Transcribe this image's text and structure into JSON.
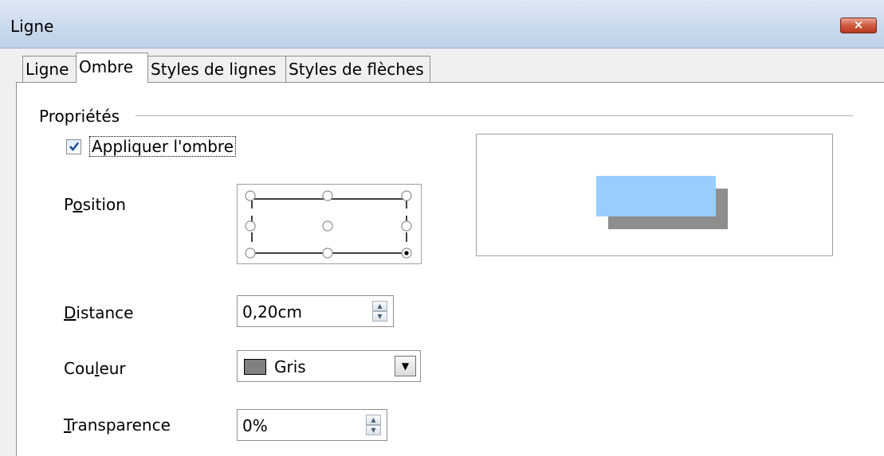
{
  "window": {
    "title": "Ligne",
    "close_label": "×"
  },
  "tabs": [
    {
      "label": "Ligne",
      "active": false
    },
    {
      "label": "Ombre",
      "active": true
    },
    {
      "label": "Styles de lignes",
      "active": false
    },
    {
      "label": "Styles de flèches",
      "active": false
    }
  ],
  "section": {
    "title": "Propriétés"
  },
  "apply_shadow": {
    "label": "Appliquer l'ombre",
    "checked": true
  },
  "position": {
    "label_prefix": "P",
    "label_mnemonic": "o",
    "label_suffix": "sition",
    "selected": "bottom-right"
  },
  "distance": {
    "label_mnemonic": "D",
    "label_suffix": "istance",
    "value": "0,20cm"
  },
  "color": {
    "label_prefix": "Cou",
    "label_mnemonic": "l",
    "label_suffix": "eur",
    "value": "Gris",
    "swatch": "#808080"
  },
  "transparency": {
    "label_mnemonic": "T",
    "label_suffix": "ransparence",
    "value": "0%"
  },
  "preview": {
    "shape_color": "#99ccff",
    "shadow_color": "#8e8e8e"
  },
  "icons": {
    "spin_up": "▲",
    "spin_down": "▼",
    "dropdown": "▼"
  }
}
